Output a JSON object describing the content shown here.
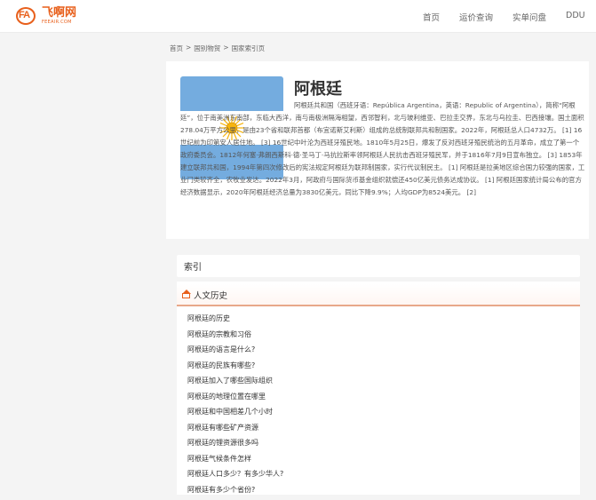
{
  "site": {
    "logo_mark": "FA",
    "logo_cn": "飞啊网",
    "logo_en": "FEEAIR.COM"
  },
  "nav": [
    {
      "label": "首页"
    },
    {
      "label": "运价查询"
    },
    {
      "label": "实单问盘"
    },
    {
      "label": "DDU"
    }
  ],
  "breadcrumb": [
    "首页",
    ">",
    "国别物贸",
    ">",
    "国家索引页"
  ],
  "country": {
    "name": "阿根廷",
    "description": "阿根廷共和国（西班牙语：República Argentina，英语：Republic of Argentina），简称“阿根廷”，位于南美洲东南部，东临大西洋，南与南极洲隔海相望，西邻智利，北与玻利维亚、巴拉圭交界，东北与乌拉圭、巴西接壤。国土面积278.04万平方公里，是由23个省和联邦首都（布宜诺斯艾利斯）组成的总统制联邦共和制国家。2022年，阿根廷总人口4732万。 [1] 16世纪前为印第安人居住地。 [3] 16世纪中叶沦为西班牙殖民地。1810年5月25日，爆发了反对西班牙殖民统治的五月革命，成立了第一个政府委员会。1812年何塞·弗朗西斯科·德·圣马丁·马抗拉斯率领阿根廷人民抗击西班牙殖民军，并于1816年7月9日宣布独立。 [3] 1853年建立联邦共和国，1994年第四次修改后的宪法规定阿根廷为联邦制国家，实行代议制民主。 [1] 阿根廷是拉美地区综合国力较强的国家，工业门类较齐全，农牧业发达。2022年3月，阿政府与国际货币基金组织就偿还450亿美元债务达成协议。 [1] 阿根廷国家统计局公布的官方经济数据显示，2020年阿根廷经济总量为3830亿美元，同比下降9.9%；人均GDP为8524美元。 [2]"
  },
  "index": {
    "label": "索引",
    "category": "人文历史",
    "items": [
      "阿根廷的历史",
      "阿根廷的宗教和习俗",
      "阿根廷的语言是什么?",
      "阿根廷的民族有哪些?",
      "阿根廷加入了哪些国际组织",
      "阿根廷的地理位置在哪里",
      "阿根廷和中国相差几个小时",
      "阿根廷有哪些矿产资源",
      "阿根廷的锂资源很多吗",
      "阿根廷气候条件怎样",
      "阿根廷人口多少？有多少华人?",
      "阿根廷有多少个省份?"
    ]
  },
  "colors": {
    "brand": "#e8601c",
    "flag_blue": "#74acdf",
    "sun": "#f6b40e"
  }
}
